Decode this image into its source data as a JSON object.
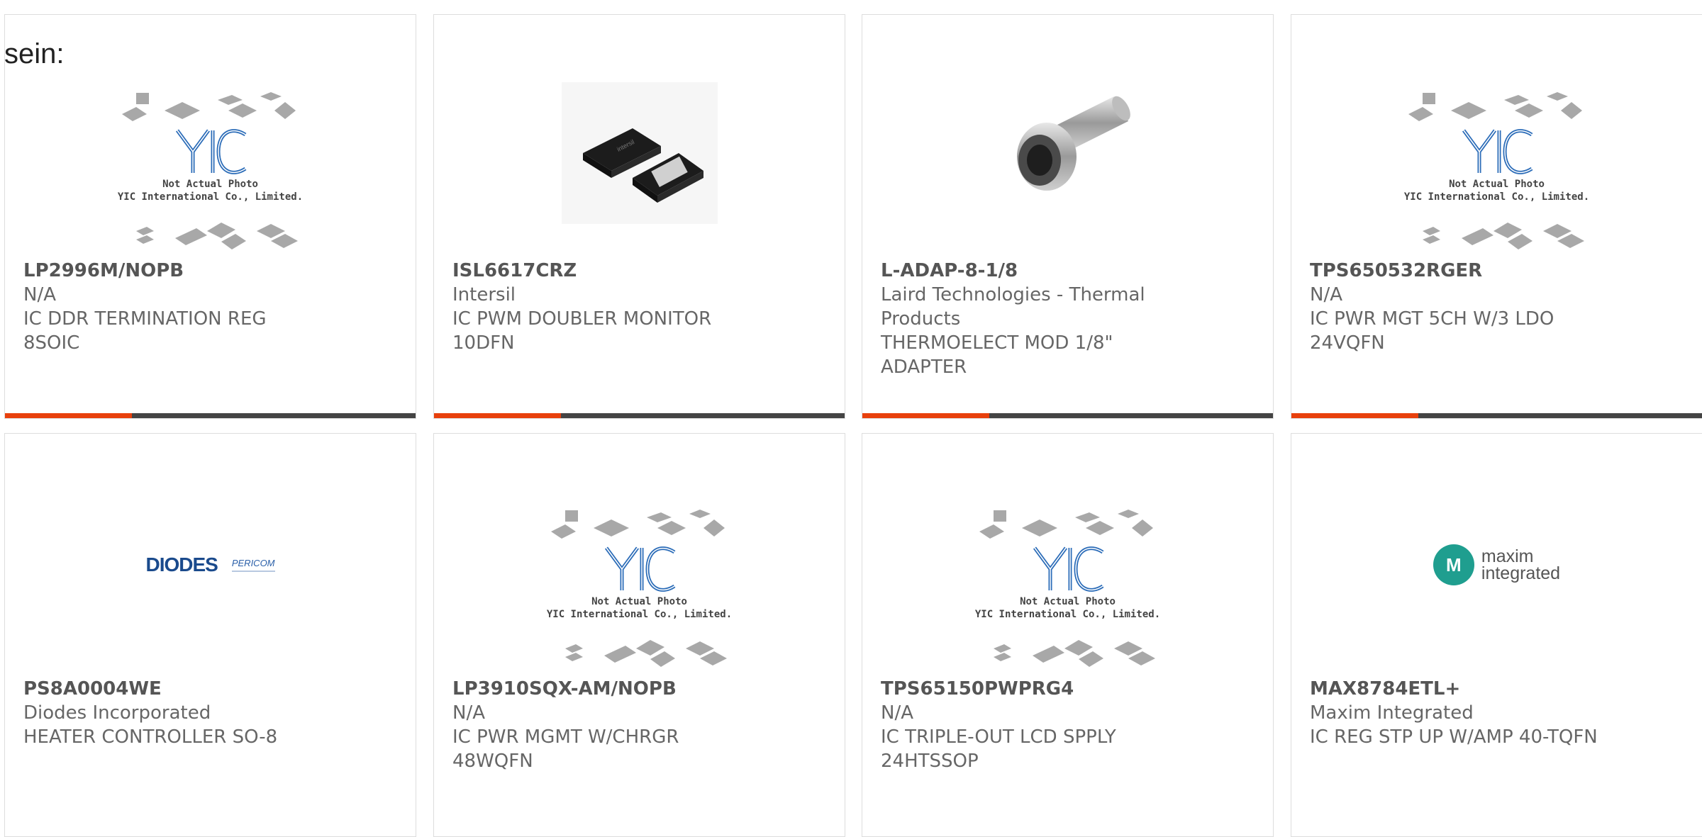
{
  "intro_text": "sein:",
  "placeholder": {
    "line1": "Not Actual Photo",
    "line2": "YIC International Co., Limited.",
    "logo": "YIC"
  },
  "brand_logos": {
    "diodes": {
      "name": "DIODES",
      "sub": "PERICOM"
    },
    "maxim": {
      "mark": "M",
      "line1": "maxim",
      "line2": "integrated"
    }
  },
  "colors": {
    "accent": "#e8400c",
    "bar": "#444444",
    "text": "#666666"
  },
  "products": [
    {
      "part": "LP2996M/NOPB",
      "manufacturer": "N/A",
      "description": "IC DDR TERMINATION REG 8SOIC",
      "image": "placeholder",
      "progress": 0.31
    },
    {
      "part": "ISL6617CRZ",
      "manufacturer": "Intersil",
      "description": "IC PWM DOUBLER MONITOR 10DFN",
      "image": "chip-photo",
      "progress": 0.31
    },
    {
      "part": "L-ADAP-8-1/8",
      "manufacturer": "Laird Technologies - Thermal Products",
      "description": "THERMOELECT MOD 1/8\" ADAPTER",
      "image": "adapter-photo",
      "progress": 0.31
    },
    {
      "part": "TPS650532RGER",
      "manufacturer": "N/A",
      "description": "IC PWR MGT 5CH W/3 LDO 24VQFN",
      "image": "placeholder",
      "progress": 0.31
    },
    {
      "part": "PS8A0004WE",
      "manufacturer": "Diodes Incorporated",
      "description": "HEATER CONTROLLER SO-8",
      "image": "diodes-logo"
    },
    {
      "part": "LP3910SQX-AM/NOPB",
      "manufacturer": "N/A",
      "description": "IC PWR MGMT W/CHRGR 48WQFN",
      "image": "placeholder"
    },
    {
      "part": "TPS65150PWPRG4",
      "manufacturer": "N/A",
      "description": "IC TRIPLE-OUT LCD SPPLY 24HTSSOP",
      "image": "placeholder"
    },
    {
      "part": "MAX8784ETL+",
      "manufacturer": "Maxim Integrated",
      "description": "IC REG STP UP W/AMP 40-TQFN",
      "image": "maxim-logo"
    }
  ]
}
